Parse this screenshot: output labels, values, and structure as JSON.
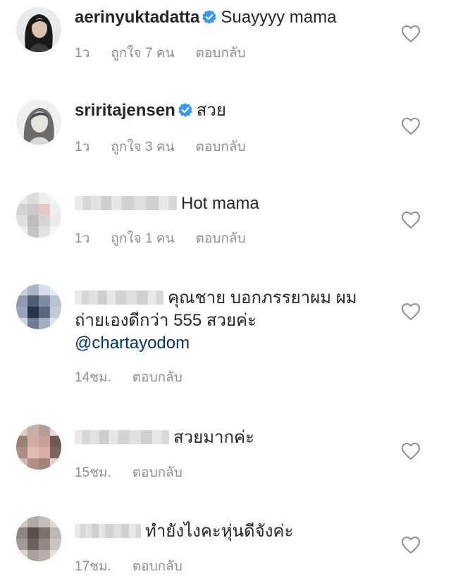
{
  "comments": [
    {
      "username": "aerinyuktadatta",
      "verified": true,
      "text": "Suayyyy mama",
      "time": "1ว",
      "likes": "ถูกใจ 7 คน",
      "reply": "ตอบกลับ"
    },
    {
      "username": "sriritajensen",
      "verified": true,
      "text": "สวย",
      "time": "1ว",
      "likes": "ถูกใจ 3 คน",
      "reply": "ตอบกลับ"
    },
    {
      "username": "",
      "verified": false,
      "text": "Hot mama",
      "time": "1ว",
      "likes": "ถูกใจ 1 คน",
      "reply": "ตอบกลับ"
    },
    {
      "username": "",
      "verified": false,
      "text": "คุณชาย บอกภรรยาผม ผม ถ่ายเองดีกว่า 555 สวยค่ะ",
      "mention": "@chartayodom",
      "time": "14ชม.",
      "reply": "ตอบกลับ"
    },
    {
      "username": "",
      "verified": false,
      "text": "สวยมากค่ะ",
      "time": "15ชม.",
      "reply": "ตอบกลับ"
    },
    {
      "username": "",
      "verified": false,
      "text": "ทำยังไงคะหุ่นดีจังค่ะ",
      "time": "17ชม.",
      "reply": "ตอบกลับ"
    }
  ],
  "colors": {
    "text": "#262626",
    "meta": "#8e8e8e",
    "verified_badge": "#3897f0",
    "mention": "#003569"
  },
  "icons": {
    "verified": "verified-badge-icon",
    "like": "heart-outline-icon"
  }
}
